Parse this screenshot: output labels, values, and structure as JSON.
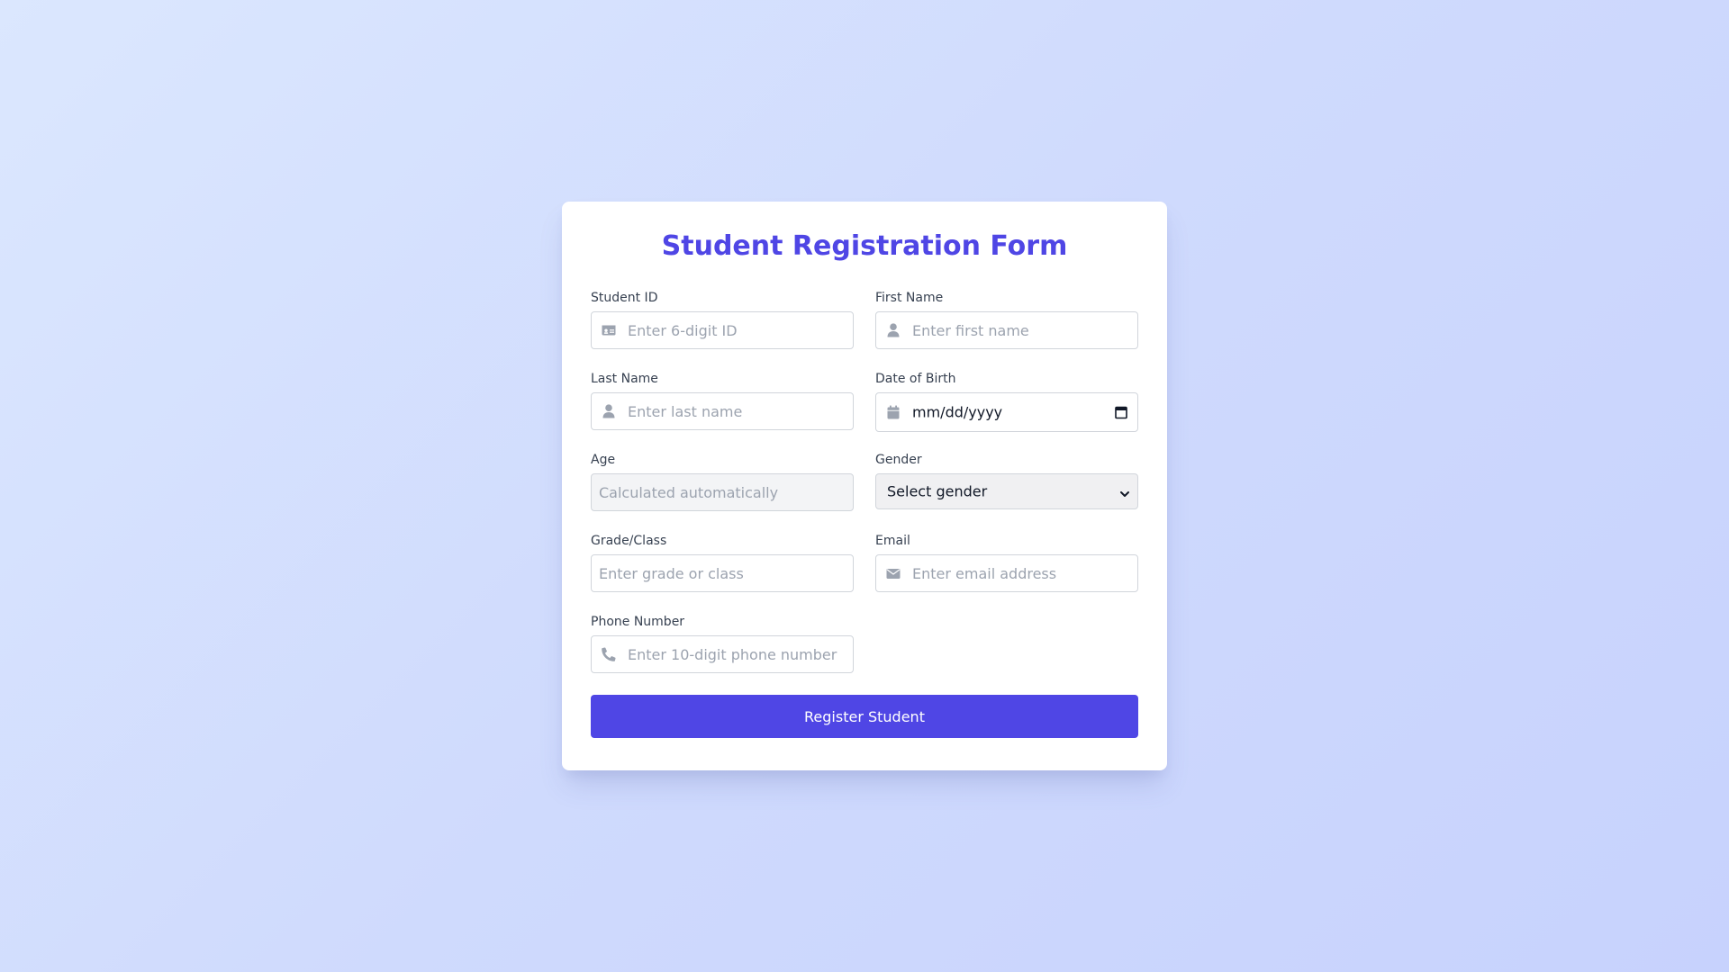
{
  "form": {
    "title": "Student Registration Form",
    "fields": {
      "student_id": {
        "label": "Student ID",
        "placeholder": "Enter 6-digit ID"
      },
      "first_name": {
        "label": "First Name",
        "placeholder": "Enter first name"
      },
      "last_name": {
        "label": "Last Name",
        "placeholder": "Enter last name"
      },
      "dob": {
        "label": "Date of Birth",
        "value": "mm/dd/yyyy"
      },
      "age": {
        "label": "Age",
        "placeholder": "Calculated automatically"
      },
      "gender": {
        "label": "Gender",
        "selected": "Select gender"
      },
      "grade": {
        "label": "Grade/Class",
        "placeholder": "Enter grade or class"
      },
      "email": {
        "label": "Email",
        "placeholder": "Enter email address"
      },
      "phone": {
        "label": "Phone Number",
        "placeholder": "Enter 10-digit phone number"
      }
    },
    "submit_label": "Register Student"
  },
  "icons": {
    "student_id": "id-card-icon",
    "first_name": "user-icon",
    "last_name": "user-icon",
    "dob": "calendar-icon",
    "email": "envelope-icon",
    "phone": "phone-icon"
  },
  "colors": {
    "accent": "#4f46e5",
    "icon": "#9ca3af"
  }
}
